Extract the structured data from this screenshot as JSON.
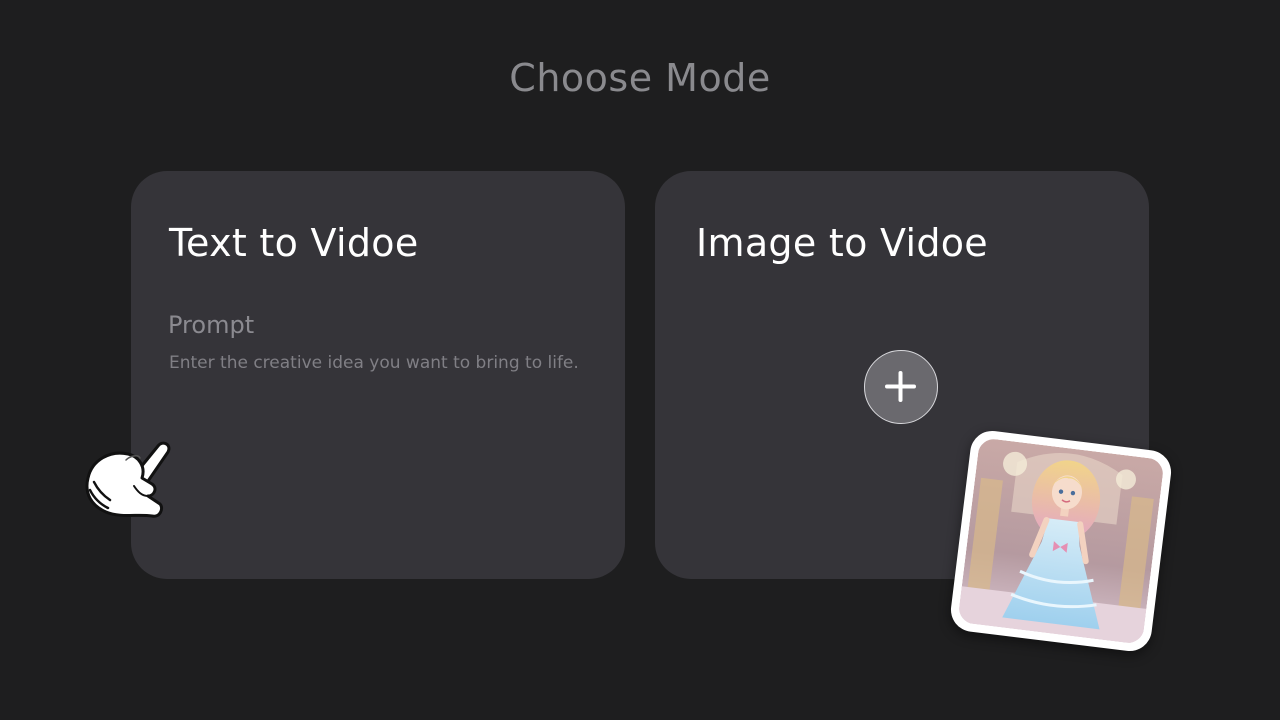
{
  "header": {
    "title": "Choose Mode"
  },
  "modes": {
    "text_to_video": {
      "title": "Text to Vidoe",
      "prompt_label": "Prompt",
      "prompt_placeholder": "Enter the creative idea you want to bring to life."
    },
    "image_to_video": {
      "title": "Image to Vidoe",
      "add_icon": "plus-icon"
    }
  },
  "overlays": {
    "cursor_icon": "pointing-hand-cursor-icon",
    "photo": "princess-in-ballgown-photo"
  },
  "colors": {
    "background": "#1e1e1f",
    "card": "#353439",
    "title_gray": "#8a8a8e",
    "add_button": "#6a696e"
  }
}
